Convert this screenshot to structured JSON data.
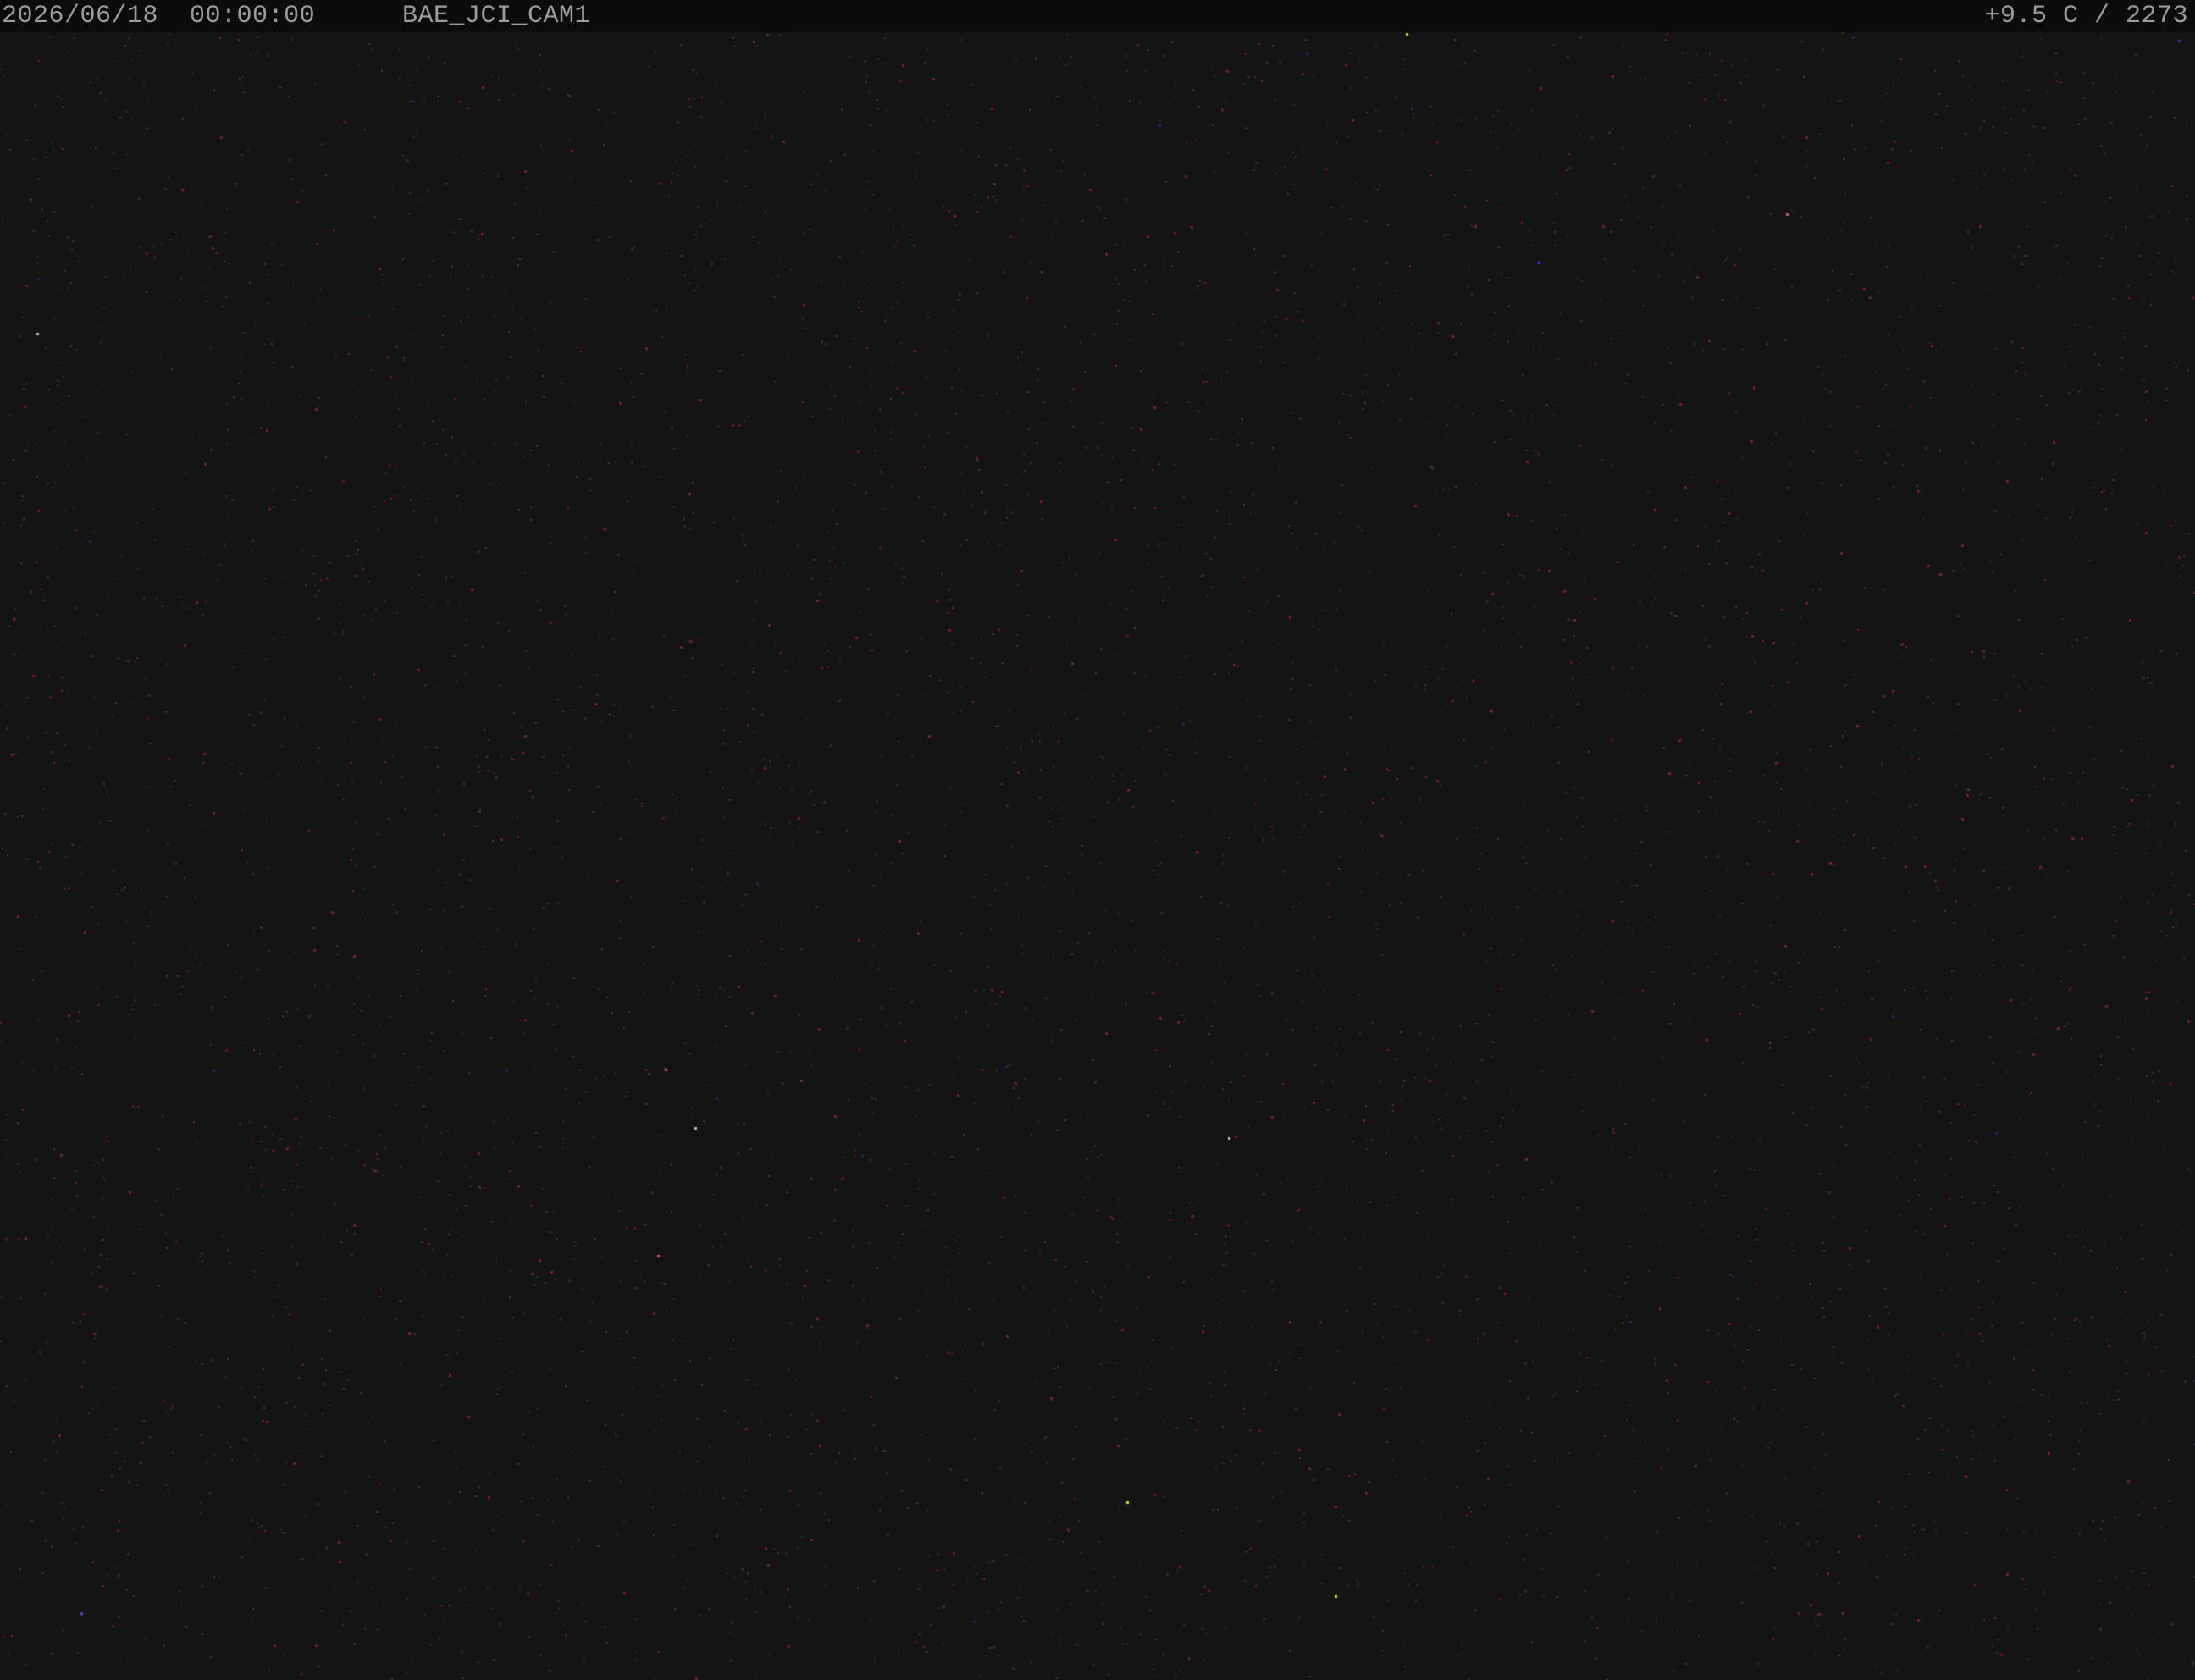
{
  "overlay": {
    "date": "2026/06/18",
    "time": "00:00:00",
    "camera_name": "BAE_JCI_CAM1",
    "status_readout": "+9.5 C / 2273"
  },
  "image": {
    "content": "dark-night-noise",
    "background_color": "#141414",
    "text_color": "#9c9c9c"
  }
}
